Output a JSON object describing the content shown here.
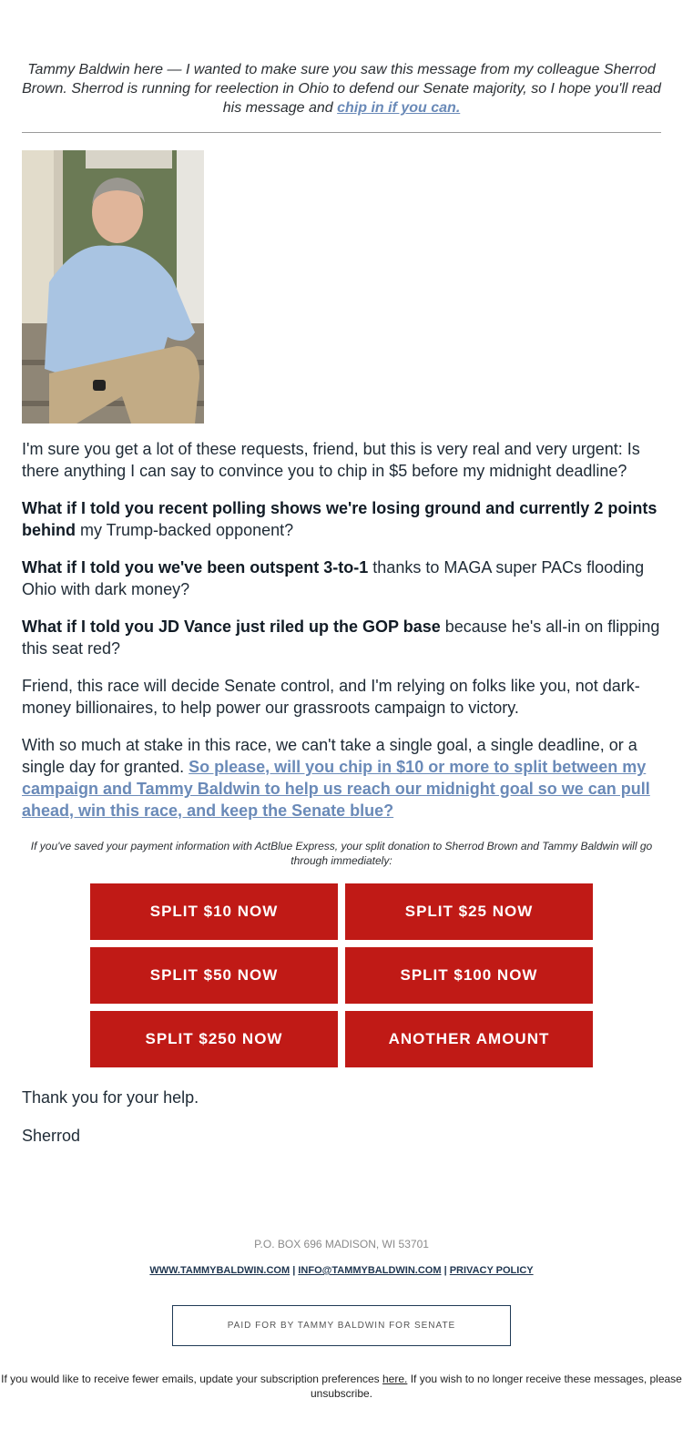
{
  "intro": {
    "text": "Tammy Baldwin here — I wanted to make sure you saw this message from my colleague Sherrod Brown. Sherrod is running for reelection in Ohio to defend our Senate majority, so I hope you'll read his message and ",
    "link": "chip in if you can."
  },
  "photo": {
    "alt": "Sherrod Brown seated on porch steps"
  },
  "body": {
    "p1": "I'm sure you get a lot of these requests, friend, but this is very real and very urgent: Is there anything I can say to convince you to chip in $5 before my midnight deadline?",
    "p2_bold": "What if I told you recent polling shows we're losing ground and currently 2 points behind",
    "p2_rest": " my Trump-backed opponent?",
    "p3_bold": "What if I told you we've been outspent 3-to-1",
    "p3_rest": " thanks to MAGA super PACs flooding Ohio with dark money?",
    "p4_bold": "What if I told you JD Vance just riled up the GOP base",
    "p4_rest": " because he's all-in on flipping this seat red?",
    "p5": "Friend, this race will decide Senate control, and I'm relying on folks like you, not dark-money billionaires, to help power our grassroots campaign to victory.",
    "p6": "With so much at stake in this race, we can't take a single goal, a single deadline, or a single day for granted. ",
    "p6_link": "So please, will you chip in $10 or more to split between my campaign and Tammy Baldwin to help us reach our midnight goal so we can pull ahead, win this race, and keep the Senate blue?"
  },
  "note": "If you've saved your payment information with ActBlue Express, your split donation to Sherrod Brown and Tammy Baldwin will go through immediately:",
  "buttons": [
    {
      "label": "SPLIT $10 NOW"
    },
    {
      "label": "SPLIT $25 NOW"
    },
    {
      "label": "SPLIT $50 NOW"
    },
    {
      "label": "SPLIT $100 NOW"
    },
    {
      "label": "SPLIT $250 NOW"
    },
    {
      "label": "ANOTHER AMOUNT"
    }
  ],
  "closing": {
    "thanks": "Thank you for your help.",
    "signature": "Sherrod"
  },
  "footer": {
    "address": "P.O. BOX 696 MADISON, WI 53701",
    "links": [
      "WWW.TAMMYBALDWIN.COM",
      "INFO@TAMMYBALDWIN.COM",
      "PRIVACY POLICY"
    ],
    "separator": " | ",
    "paid_for": "PAID FOR BY TAMMY BALDWIN FOR SENATE",
    "unsub_1": "If you would like to receive fewer emails, update your subscription preferences ",
    "unsub_link": "here.",
    "unsub_2": " If you wish to no longer receive these messages, please unsubscribe."
  },
  "colors": {
    "button": "#c01a16",
    "link": "#6a8ab8",
    "footer_link": "#1f3650"
  }
}
